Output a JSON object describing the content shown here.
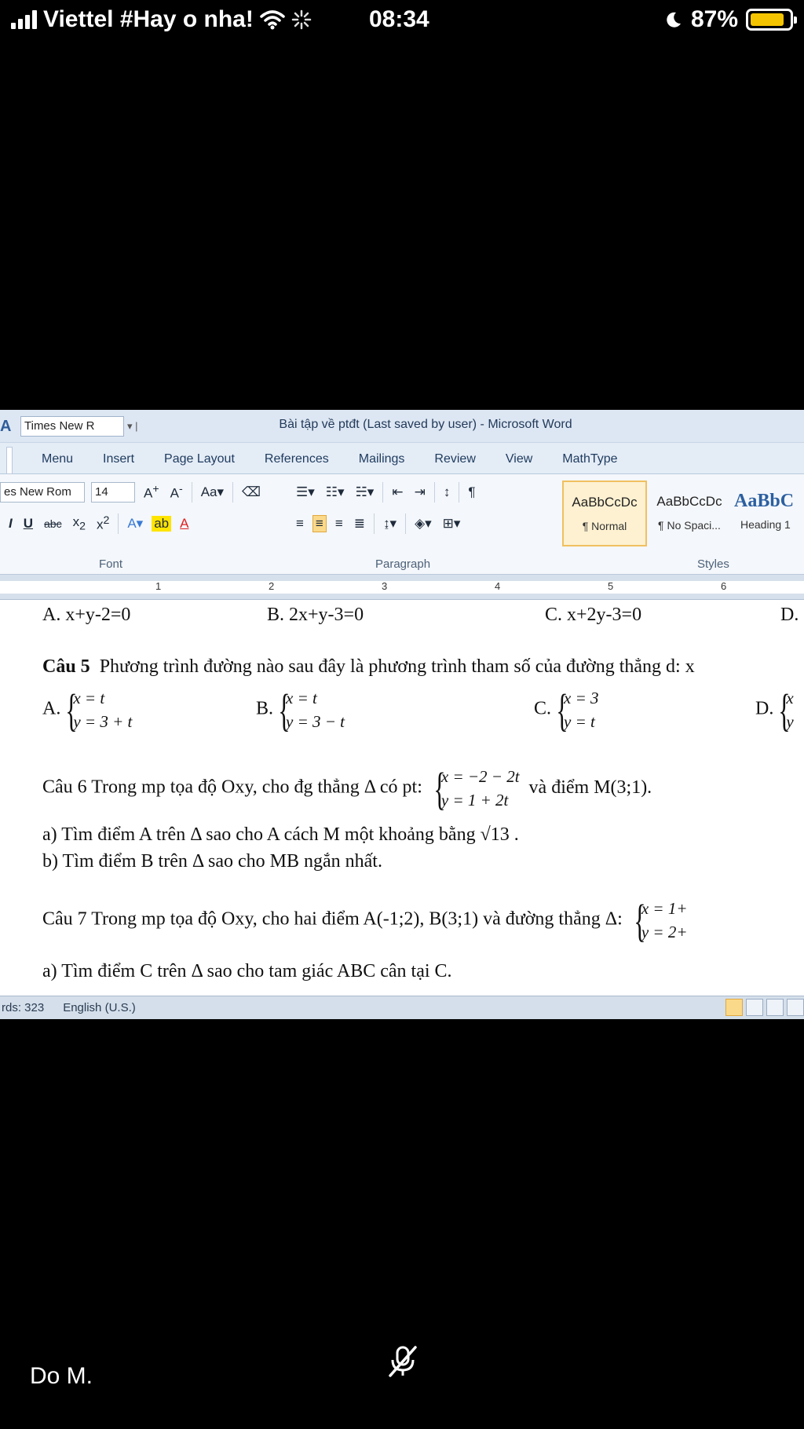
{
  "status_bar": {
    "carrier": "Viettel #Hay o nha!",
    "time": "08:34",
    "battery": "87%",
    "battery_level": 0.87,
    "icons": [
      "signal-icon",
      "wifi-icon",
      "loading-icon",
      "moon-icon",
      "battery-icon"
    ]
  },
  "word": {
    "qat_font": "Times New R",
    "window_title": "Bài tập về ptđt (Last saved by user)  -  Microsoft Word",
    "tabs": [
      "Menu",
      "Insert",
      "Page Layout",
      "References",
      "Mailings",
      "Review",
      "View",
      "MathType"
    ],
    "ribbon": {
      "font_name": "es New Rom",
      "font_size": "14",
      "font_group_label": "Font",
      "paragraph_group_label": "Paragraph",
      "styles_group_label": "Styles",
      "styles": [
        {
          "sample": "AaBbCcDc",
          "name": "¶ Normal"
        },
        {
          "sample": "AaBbCcDc",
          "name": "¶ No Spaci..."
        },
        {
          "sample": "AaBbC",
          "name": "Heading 1"
        }
      ]
    },
    "ruler_numbers": [
      "1",
      "2",
      "3",
      "4",
      "5",
      "6"
    ],
    "document": {
      "q4_answers": [
        "A. x+y-2=0",
        "B. 2x+y-3=0",
        "C. x+2y-3=0",
        "D."
      ],
      "q5_label": "Câu 5",
      "q5_text": "Phương trình đường nào sau đây là phương trình tham số của đường thẳng d: x",
      "q5_options": [
        {
          "letter": "A.",
          "l1": "x = t",
          "l2": "y = 3 + t"
        },
        {
          "letter": "B.",
          "l1": "x = t",
          "l2": "y = 3 − t"
        },
        {
          "letter": "C.",
          "l1": "x = 3",
          "l2": "y = t"
        },
        {
          "letter": "D.",
          "l1": "x",
          "l2": "y"
        }
      ],
      "q6_text_a": "Câu 6  Trong mp tọa độ Oxy, cho đg thẳng Δ có pt:",
      "q6_sys": {
        "l1": "x = −2 − 2t",
        "l2": "y = 1 + 2t"
      },
      "q6_text_b": "và điểm M(3;1).",
      "q6_a": "a) Tìm điểm A trên Δ sao cho A cách M một khoảng bằng √13 .",
      "q6_b": "b) Tìm điểm B trên  Δ sao cho MB ngắn nhất.",
      "q7_text": "Câu 7  Trong mp tọa độ Oxy, cho hai điểm A(-1;2), B(3;1) và đường thẳng Δ:",
      "q7_sys": {
        "l1": "x = 1+",
        "l2": "y = 2+"
      },
      "q7_a": "a) Tìm điểm C trên Δ sao cho tam giác ABC cân tại C."
    },
    "statusbar": {
      "words": "rds: 323",
      "language": "English (U.S.)"
    }
  },
  "call": {
    "caller_name": "Do M."
  },
  "colors": {
    "battery_fill": "#f5c400",
    "word_title_bg": "#dde7f3",
    "active_style": "#fdf1d1"
  }
}
